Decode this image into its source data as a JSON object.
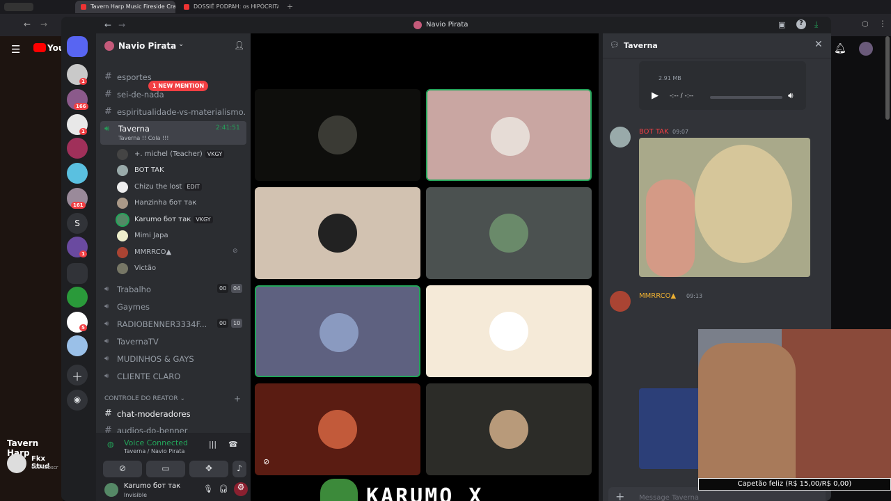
{
  "browser": {
    "tabs": [
      {
        "label": "Tavern Harp Music Fireside Cra"
      },
      {
        "label": "DOSSIÊ PODPAH: os HIPÓCRITA"
      }
    ],
    "new_tab": "+"
  },
  "youtube": {
    "logo": "You",
    "video_title": "Tavern Harp",
    "channel": "Fkx Stud",
    "subs": "658 subscr"
  },
  "window": {
    "title": "Navio Pirata"
  },
  "server": {
    "name": "Navio Pirata"
  },
  "servers": {
    "badges": [
      "1",
      "166",
      "1",
      "161",
      "1",
      "5"
    ],
    "letter": "S"
  },
  "mention_pill": "1 NEW MENTION",
  "channels": {
    "top": [
      "esportes",
      "sei-de-nada",
      "espiritualidade-vs-materialismo..."
    ],
    "voice_active": {
      "name": "Taverna",
      "status": "Taverna !! Cola !!!",
      "timer": "2:41:51"
    },
    "voice_users": [
      {
        "name": "+. michel (Teacher)",
        "tag": "VKGY"
      },
      {
        "name": "BOT TAK",
        "tag": ""
      },
      {
        "name": "Chizu the lost",
        "tag": "EDIT"
      },
      {
        "name": "Hanzinha бот так",
        "tag": ""
      },
      {
        "name": "Karumo бот так",
        "tag": "VKGY"
      },
      {
        "name": "Mimi Japa",
        "tag": ""
      },
      {
        "name": "MMRRCO▲",
        "tag": ""
      },
      {
        "name": "Victão",
        "tag": ""
      }
    ],
    "voice_other": [
      {
        "name": "Trabalho",
        "a": "00",
        "b": "04"
      },
      {
        "name": "Gaymes",
        "a": "",
        "b": ""
      },
      {
        "name": "RADIOBENNER3334F...",
        "a": "00",
        "b": "10"
      },
      {
        "name": "TavernaTV",
        "a": "",
        "b": ""
      },
      {
        "name": "MUDINHOS & GAYS",
        "a": "",
        "b": ""
      },
      {
        "name": "CLIENTE CLARO",
        "a": "",
        "b": ""
      }
    ],
    "category": "CONTROLE DO REATOR",
    "text_ch": [
      "chat-moderadores",
      "audios-do-benner"
    ]
  },
  "voice_panel": {
    "status": "Voice Connected",
    "location": "Taverna / Navio Pirata"
  },
  "user_panel": {
    "name": "Karumo бот так",
    "status": "Invisible"
  },
  "overlay": {
    "streamer_name": "KARUMO_X",
    "donation": "Capetão feliz (R$ 15,00/R$ 0,00)"
  },
  "chat": {
    "title": "Taverna",
    "file_size": "2.91 MB",
    "audio_time": "-:-- / -:--",
    "messages": [
      {
        "author": "BOT TAK",
        "time": "09:07"
      },
      {
        "author": "MMRRCO▲",
        "time": "09:13"
      }
    ],
    "input_placeholder": "Message Taverna"
  },
  "colors": {
    "accent": "#5865f2",
    "online": "#23a55a",
    "danger": "#f23f43",
    "bot_author": "#f23f43",
    "mmrrco_author": "#f0b232"
  }
}
